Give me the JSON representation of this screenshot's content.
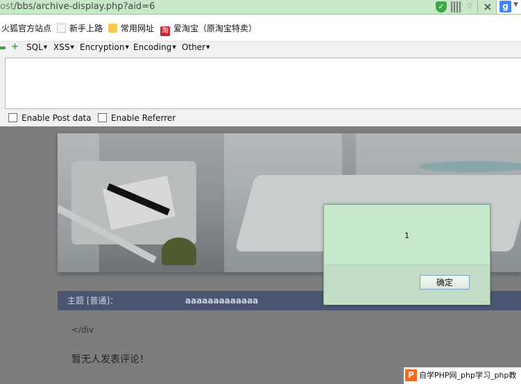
{
  "address_bar": {
    "host_fragment": "ost",
    "path": "/bbs/archive-display.php?aid=6",
    "search_engine_letter": "g"
  },
  "bookmarks": [
    {
      "label": "火狐官方站点",
      "icon": "firefox-icon"
    },
    {
      "label": "新手上路",
      "icon": "dotted-page-icon"
    },
    {
      "label": "常用网址",
      "icon": "folder-icon"
    },
    {
      "label": "爱淘宝（原淘宝特卖）",
      "icon": "taobao-icon",
      "icon_glyph": "淘"
    }
  ],
  "hackbar": {
    "menu": [
      {
        "label": "SQL"
      },
      {
        "label": "XSS"
      },
      {
        "label": "Encryption"
      },
      {
        "label": "Encoding"
      },
      {
        "label": "Other"
      }
    ],
    "textarea_value": "",
    "enable_post_label": "Enable Post data",
    "enable_referrer_label": "Enable Referrer",
    "enable_post_checked": false,
    "enable_referrer_checked": false
  },
  "page": {
    "thread_label": "主题 [普通]：",
    "thread_title": "aaaaaaaaaaaaa",
    "code_text": "</div",
    "no_comment_text": "暂无人发表评论！"
  },
  "dialog": {
    "message": "1",
    "ok_label": "确定"
  },
  "watermark": {
    "logo_letter": "P",
    "text": "自学PHP网_php学习_php教"
  },
  "colors": {
    "address_bar_bg": "#c8e8c8",
    "dialog_bg": "#c7e9cb",
    "thread_bar_bg": "#4a5672",
    "overlay_bg": "#7b7d7f"
  }
}
